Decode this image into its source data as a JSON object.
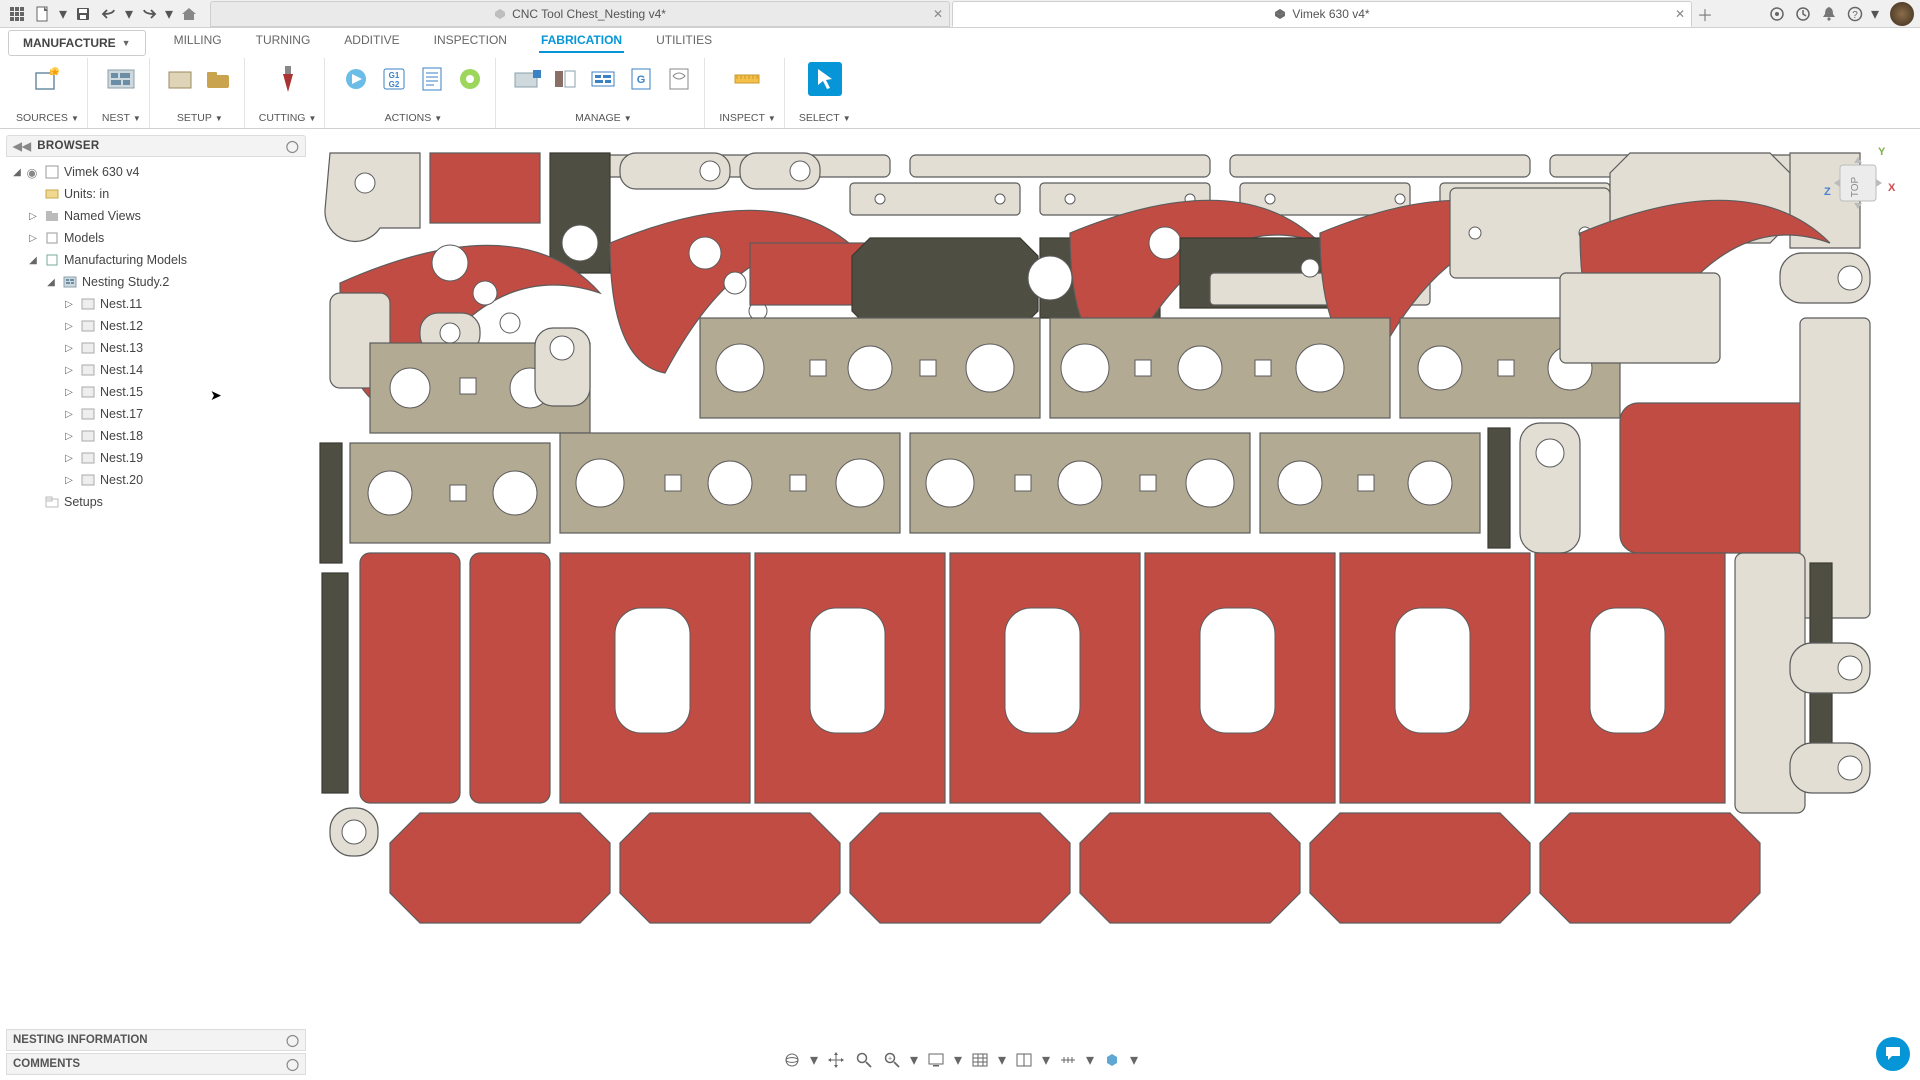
{
  "sysbar": {
    "icons_left": [
      "grid-icon",
      "file-new-icon",
      "caret",
      "save-icon",
      "undo-icon",
      "caret",
      "redo-icon",
      "caret",
      "home-icon"
    ],
    "icons_right": [
      "extensions-icon",
      "clock-icon",
      "bell-icon",
      "help-icon",
      "caret"
    ]
  },
  "tabs": [
    {
      "title": "CNC Tool Chest_Nesting v4*",
      "active": false
    },
    {
      "title": "Vimek 630 v4*",
      "active": true
    }
  ],
  "workspace": {
    "label": "MANUFACTURE"
  },
  "ribbon_tabs": [
    {
      "label": "MILLING"
    },
    {
      "label": "TURNING"
    },
    {
      "label": "ADDITIVE"
    },
    {
      "label": "INSPECTION"
    },
    {
      "label": "FABRICATION",
      "active": true
    },
    {
      "label": "UTILITIES"
    }
  ],
  "tool_groups": {
    "sources": "SOURCES",
    "nest": "NEST",
    "setup": "SETUP",
    "cutting": "CUTTING",
    "actions": "ACTIONS",
    "manage": "MANAGE",
    "inspect": "INSPECT",
    "select": "SELECT"
  },
  "browser": {
    "title": "BROWSER",
    "root": "Vimek 630 v4",
    "units": "Units: in",
    "named_views": "Named Views",
    "models": "Models",
    "manu_models": "Manufacturing Models",
    "nesting_study": "Nesting Study.2",
    "nests": [
      "Nest.11",
      "Nest.12",
      "Nest.13",
      "Nest.14",
      "Nest.15",
      "Nest.17",
      "Nest.18",
      "Nest.19",
      "Nest.20"
    ],
    "setups": "Setups"
  },
  "panels": {
    "nesting_info": "NESTING INFORMATION",
    "comments": "COMMENTS"
  },
  "viewcube": {
    "face": "TOP",
    "x": "X",
    "y": "Y",
    "z": "Z"
  }
}
